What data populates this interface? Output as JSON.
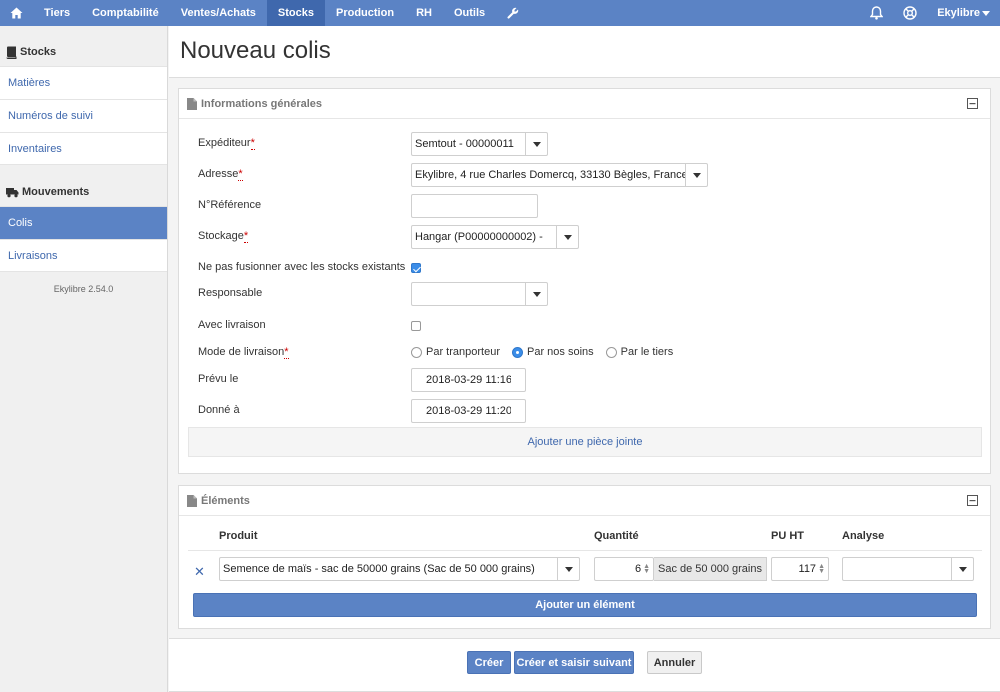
{
  "colors": {
    "brand": "#5b83c5",
    "active_nav": "#3f68ad",
    "link": "#3f68ad",
    "required": "#cc0000",
    "checkbox_on": "#3b8de8"
  },
  "topnav": {
    "home_icon": "home-icon",
    "items": [
      "Tiers",
      "Comptabilité",
      "Ventes/Achats",
      "Stocks",
      "Production",
      "RH",
      "Outils"
    ],
    "active": "Stocks",
    "tools_icon": "wrench-icon",
    "bell_icon": "bell-icon",
    "globe_icon": "globe-icon",
    "user": "Ekylibre"
  },
  "sidebar": {
    "section1": {
      "label": "Stocks",
      "icon": "book-icon"
    },
    "links1": [
      "Matières",
      "Numéros de suivi",
      "Inventaires"
    ],
    "section2": {
      "label": "Mouvements",
      "icon": "truck-icon"
    },
    "links2": [
      "Colis",
      "Livraisons"
    ],
    "active": "Colis",
    "version": "Ekylibre 2.54.0"
  },
  "page": {
    "title": "Nouveau colis"
  },
  "general": {
    "title": "Informations générales",
    "fields": {
      "sender": {
        "label": "Expéditeur",
        "required": "*",
        "value": "Semtout - 00000011"
      },
      "address": {
        "label": "Adresse",
        "required": "*",
        "value": "Ekylibre, 4 rue Charles Domercq, 33130 Bègles, France"
      },
      "reference": {
        "label": "N°Référence",
        "value": ""
      },
      "storage": {
        "label": "Stockage",
        "required": "*",
        "value": "Hangar (P00000000002) -"
      },
      "no_merge": {
        "label": "Ne pas fusionner avec les stocks existants",
        "checked": true
      },
      "responsible": {
        "label": "Responsable",
        "value": ""
      },
      "with_delivery": {
        "label": "Avec livraison",
        "checked": false
      },
      "delivery_mode": {
        "label": "Mode de livraison",
        "required": "*",
        "options": [
          "Par tranporteur",
          "Par nos soins",
          "Par le tiers"
        ],
        "selected": "Par nos soins"
      },
      "planned_at": {
        "label": "Prévu le",
        "value": "2018-03-29 11:16"
      },
      "given_at": {
        "label": "Donné à",
        "value": "2018-03-29 11:20"
      }
    },
    "attach": "Ajouter une pièce jointe"
  },
  "elements": {
    "title": "Éléments",
    "columns": [
      "Produit",
      "Quantité",
      "PU HT",
      "Analyse"
    ],
    "rows": [
      {
        "product": "Semence de maïs - sac de 50000 grains (Sac de 50 000 grains)",
        "quantity": "6",
        "unit": "Sac de 50 000 grains",
        "unit_price": "117",
        "analysis": ""
      }
    ],
    "add": "Ajouter un élément"
  },
  "actions": {
    "create": "Créer",
    "create_next": "Créer et saisir suivant",
    "cancel": "Annuler"
  }
}
